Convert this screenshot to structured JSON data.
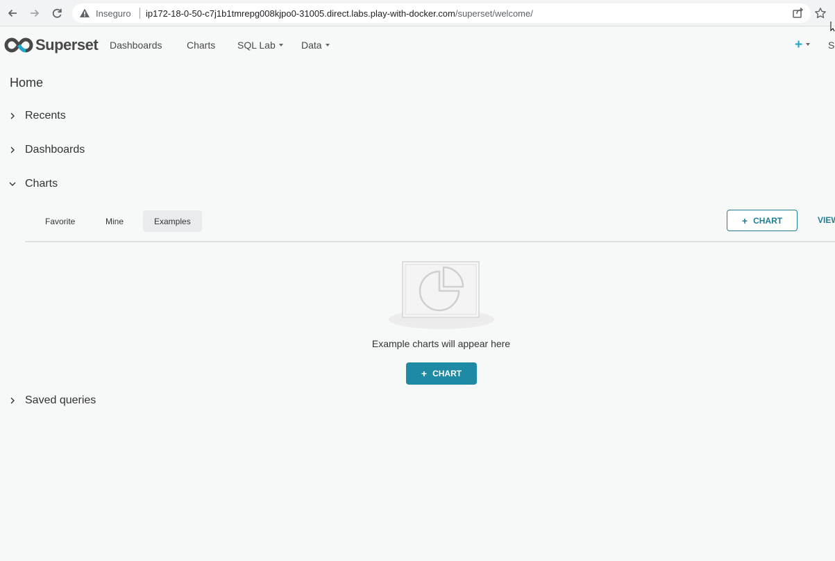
{
  "browser": {
    "security_label": "Inseguro",
    "url_host": "ip172-18-0-50-c7j1b1tmrepg008kjpo0-31005.direct.labs.play-with-docker.com",
    "url_path": "/superset/welcome/"
  },
  "navbar": {
    "brand": "Superset",
    "menu": {
      "dashboards": "Dashboards",
      "charts": "Charts",
      "sql_lab": "SQL Lab",
      "data": "Data"
    },
    "plus": "+",
    "settings_partial": "S"
  },
  "home": {
    "title": "Home",
    "sections": {
      "recents": "Recents",
      "dashboards": "Dashboards",
      "charts": "Charts",
      "saved_queries": "Saved queries"
    },
    "charts_panel": {
      "tabs": {
        "favorite": "Favorite",
        "mine": "Mine",
        "examples": "Examples"
      },
      "active_tab": "Examples",
      "add_chart_label": "CHART",
      "view_all_partial": "VIEW",
      "empty_message": "Example charts will appear here",
      "empty_add_label": "CHART"
    }
  },
  "colors": {
    "primary": "#1f8aa4",
    "primary_dark": "#1f7d95",
    "accent_plus": "#20a7c9",
    "background": "#f7f8f8"
  }
}
